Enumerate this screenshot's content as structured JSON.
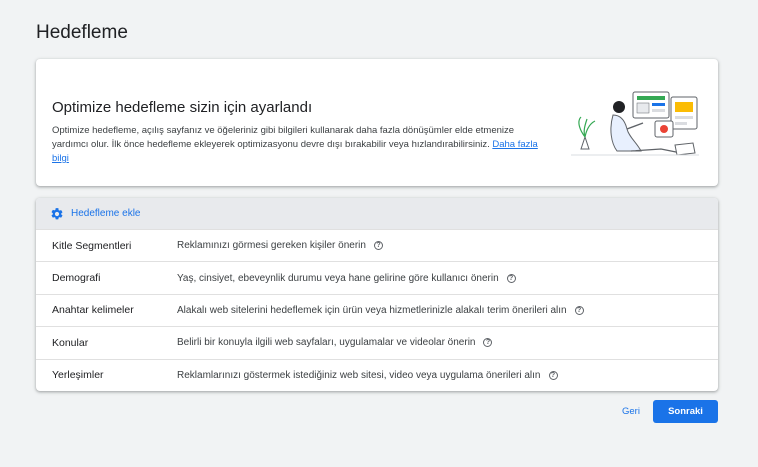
{
  "page": {
    "title": "Hedefleme"
  },
  "intro": {
    "title": "Optimize hedefleme sizin için ayarlandı",
    "description": "Optimize hedefleme, açılış sayfanız ve öğeleriniz gibi bilgileri kullanarak daha fazla dönüşümler elde etmenize yardımcı olur. İlk önce hedefleme ekleyerek optimizasyonu devre dışı bırakabilir veya hızlandırabilirsiniz.",
    "link": "Daha fazla bilgi"
  },
  "targeting": {
    "add_label": "Hedefleme ekle",
    "items": [
      {
        "name": "Kitle Segmentleri",
        "desc": "Reklamınızı görmesi gereken kişiler önerin"
      },
      {
        "name": "Demografi",
        "desc": "Yaş, cinsiyet, ebeveynlik durumu veya hane gelirine göre kullanıcı önerin"
      },
      {
        "name": "Anahtar kelimeler",
        "desc": "Alakalı web sitelerini hedeflemek için ürün veya hizmetlerinizle alakalı terim önerileri alın"
      },
      {
        "name": "Konular",
        "desc": "Belirli bir konuyla ilgili web sayfaları, uygulamalar ve videolar önerin"
      },
      {
        "name": "Yerleşimler",
        "desc": "Reklamlarınızı göstermek istediğiniz web sitesi, video veya uygulama önerileri alın"
      }
    ]
  },
  "footer": {
    "back_label": "Geri",
    "next_label": "Sonraki"
  },
  "colors": {
    "accent": "#1a73e8",
    "background": "#f1f3f4"
  },
  "icons": {
    "add": "gear-icon",
    "help": "help-icon"
  }
}
